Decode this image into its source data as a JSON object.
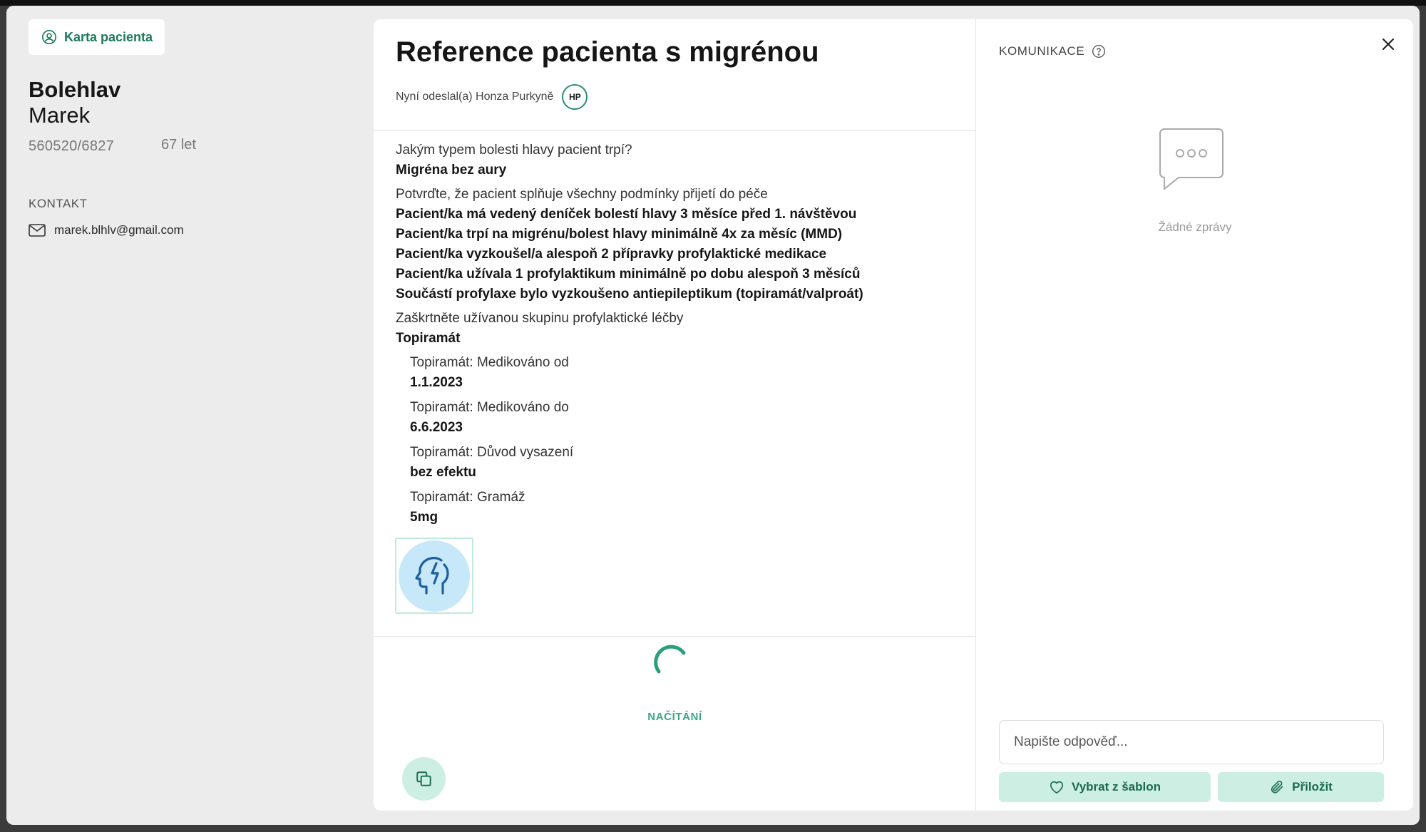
{
  "patient": {
    "card_button": "Karta pacienta",
    "surname": "Bolehlav",
    "firstname": "Marek",
    "birth_number": "560520/6827",
    "age": "67 let",
    "contact_heading": "KONTAKT",
    "email": "marek.blhlv@gmail.com"
  },
  "reference": {
    "title": "Reference pacienta s migrénou",
    "sender_text": "Nyní odeslal(a) Honza Purkyně",
    "sender_initials": "HP",
    "q1": "Jakým typem bolesti hlavy pacient trpí?",
    "a1": "Migréna bez aury",
    "q2": "Potvrďte, že pacient splňuje všechny podmínky přijetí do péče",
    "a2": [
      "Pacient/ka má vedený deníček bolestí hlavy 3 měsíce před 1. návštěvou",
      "Pacient/ka trpí na migrénu/bolest hlavy minimálně 4x za měsíc (MMD)",
      "Pacient/ka vyzkoušel/a alespoň 2 přípravky profylaktické medikace",
      "Pacient/ka užívala 1 profylaktikum minimálně po dobu alespoň 3 měsíců",
      "Součástí profylaxe bylo vyzkoušeno antiepileptikum (topiramát/valproát)"
    ],
    "q3": "Zaškrtněte užívanou skupinu profylaktické léčby",
    "a3": "Topiramát",
    "details": [
      {
        "label": "Topiramát: Medikováno od",
        "value": "1.1.2023"
      },
      {
        "label": "Topiramát: Medikováno do",
        "value": "6.6.2023"
      },
      {
        "label": "Topiramát: Důvod vysazení",
        "value": "bez efektu"
      },
      {
        "label": "Topiramát: Gramáž",
        "value": "5mg"
      }
    ],
    "loading_text": "NAČÍTÁNÍ"
  },
  "communication": {
    "heading": "KOMUNIKACE",
    "empty_text": "Žádné zprávy",
    "reply_placeholder": "Napište odpověď...",
    "template_button": "Vybrat z šablon",
    "attach_button": "Přiložit"
  },
  "colors": {
    "accent": "#1b7a5a",
    "button_bg": "#cdefe3",
    "image_bg": "#c7e8f8",
    "icon_blue": "#1f5f9e"
  }
}
